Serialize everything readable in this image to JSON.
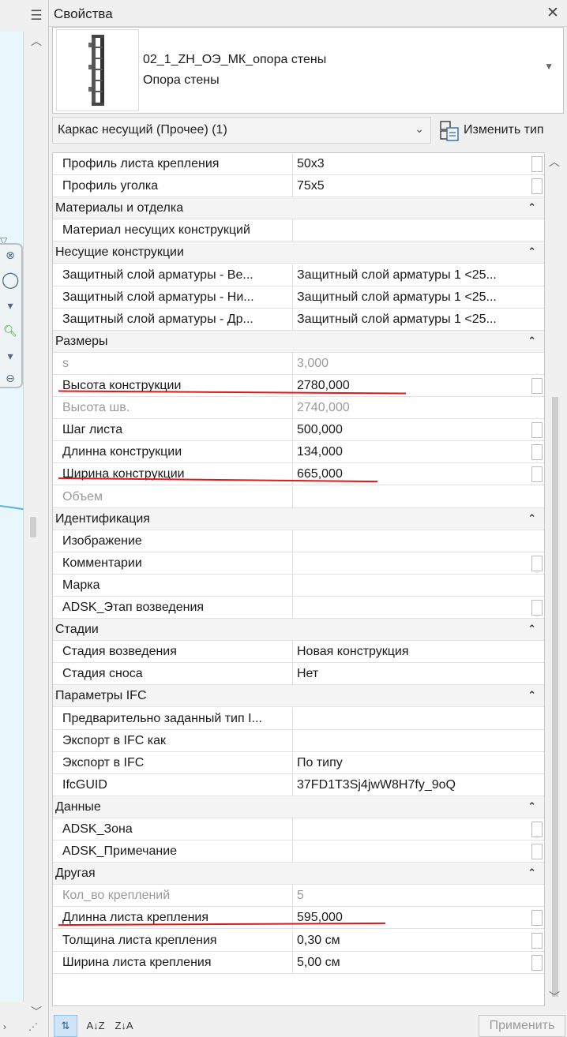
{
  "panel": {
    "title": "Свойства",
    "close_icon": "close-icon"
  },
  "type_selector": {
    "name": "02_1_ZH_ОЭ_МК_опора стены",
    "subname": "Опора стены"
  },
  "filter": {
    "label": "Каркас несущий (Прочее) (1)",
    "edit_type_label": "Изменить тип"
  },
  "rows": [
    {
      "kind": "param",
      "name": "Профиль листа крепления",
      "value": "50x3",
      "checkbox": true
    },
    {
      "kind": "param",
      "name": "Профиль уголка",
      "value": "75x5",
      "checkbox": true
    },
    {
      "kind": "category",
      "name": "Материалы и отделка"
    },
    {
      "kind": "param",
      "name": "Материал несущих конструкций",
      "value": ""
    },
    {
      "kind": "category",
      "name": "Несущие конструкции"
    },
    {
      "kind": "param",
      "name": "Защитный слой арматуры - Ве...",
      "value": "Защитный слой арматуры 1 <25..."
    },
    {
      "kind": "param",
      "name": "Защитный слой арматуры - Ни...",
      "value": "Защитный слой арматуры 1 <25..."
    },
    {
      "kind": "param",
      "name": "Защитный слой арматуры - Др...",
      "value": "Защитный слой арматуры 1 <25..."
    },
    {
      "kind": "category",
      "name": "Размеры"
    },
    {
      "kind": "param",
      "name": "s",
      "value": "3,000",
      "disabled": true
    },
    {
      "kind": "param",
      "name": "Высота конструкции",
      "value": "2780,000",
      "checkbox": true
    },
    {
      "kind": "param",
      "name": "Высота шв.",
      "value": "2740,000",
      "disabled": true
    },
    {
      "kind": "param",
      "name": "Шаг листа",
      "value": "500,000",
      "checkbox": true
    },
    {
      "kind": "param",
      "name": "Длинна конструкции",
      "value": "134,000",
      "checkbox": true
    },
    {
      "kind": "param",
      "name": "Ширина конструкции",
      "value": "665,000",
      "checkbox": true
    },
    {
      "kind": "param",
      "name": "Объем",
      "value": "",
      "disabled": true
    },
    {
      "kind": "category",
      "name": "Идентификация"
    },
    {
      "kind": "param",
      "name": "Изображение",
      "value": ""
    },
    {
      "kind": "param",
      "name": "Комментарии",
      "value": "",
      "checkbox": true
    },
    {
      "kind": "param",
      "name": "Марка",
      "value": ""
    },
    {
      "kind": "param",
      "name": "ADSK_Этап возведения",
      "value": "",
      "checkbox": true
    },
    {
      "kind": "category",
      "name": "Стадии"
    },
    {
      "kind": "param",
      "name": "Стадия возведения",
      "value": "Новая конструкция"
    },
    {
      "kind": "param",
      "name": "Стадия сноса",
      "value": "Нет"
    },
    {
      "kind": "category",
      "name": "Параметры IFC"
    },
    {
      "kind": "param",
      "name": "Предварительно заданный тип I...",
      "value": ""
    },
    {
      "kind": "param",
      "name": "Экспорт в IFC как",
      "value": ""
    },
    {
      "kind": "param",
      "name": "Экспорт в IFC",
      "value": "По типу"
    },
    {
      "kind": "param",
      "name": "IfcGUID",
      "value": "37FD1T3Sj4jwW8H7fy_9oQ"
    },
    {
      "kind": "category",
      "name": "Данные"
    },
    {
      "kind": "param",
      "name": "ADSK_Зона",
      "value": "",
      "checkbox": true
    },
    {
      "kind": "param",
      "name": "ADSK_Примечание",
      "value": "",
      "checkbox": true
    },
    {
      "kind": "category",
      "name": "Другая"
    },
    {
      "kind": "param",
      "name": "Кол_во креплений",
      "value": "5",
      "disabled": true
    },
    {
      "kind": "param",
      "name": "Длинна листа крепления",
      "value": "595,000",
      "checkbox": true
    },
    {
      "kind": "param",
      "name": "Толщина листа крепления",
      "value": "0,30 см",
      "checkbox": true
    },
    {
      "kind": "param",
      "name": "Ширина листа крепления",
      "value": "5,00 см",
      "checkbox": true
    }
  ],
  "bottom": {
    "sort_category": "⇅",
    "sort_az": "A↓Z",
    "sort_za": "Z↓A",
    "apply_label": "Применить"
  },
  "colors": {
    "accent_red": "#e01818",
    "canvas_blue": "#e7f7fc"
  }
}
